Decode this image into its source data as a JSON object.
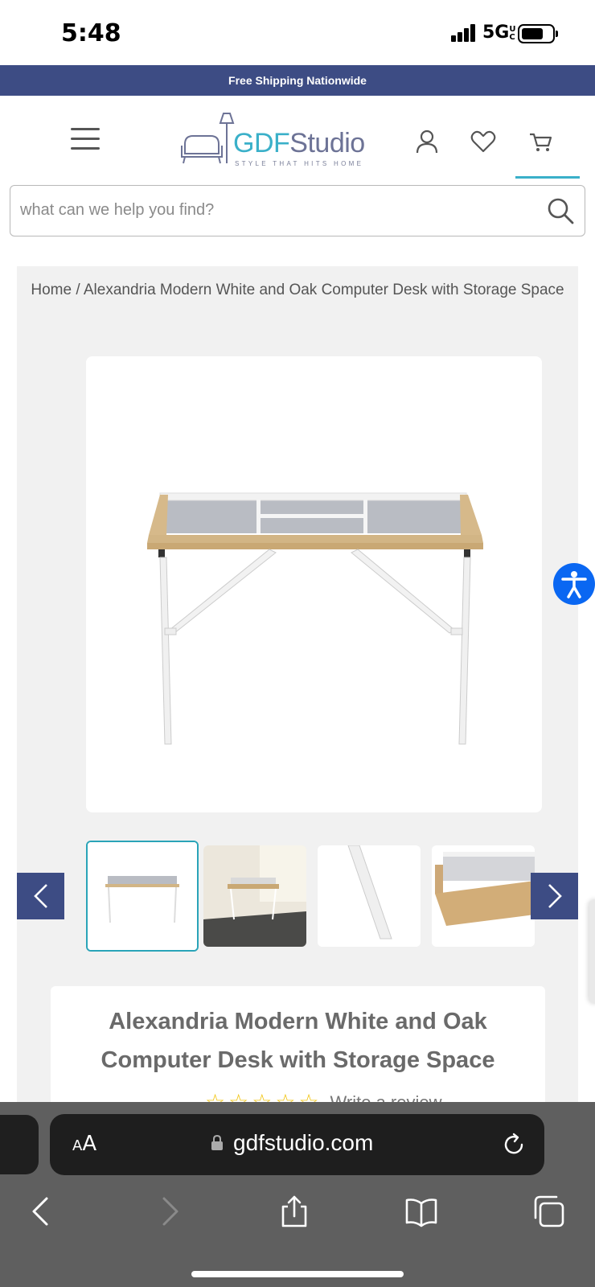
{
  "status_bar": {
    "time": "5:48",
    "network": "5G",
    "network_suffix": "UC"
  },
  "promo": {
    "text": "Free Shipping Nationwide"
  },
  "header": {
    "logo_gdf": "GDF",
    "logo_studio": "Studio",
    "logo_tagline": "STYLE THAT HITS HOME",
    "icons": [
      "menu-icon",
      "account-icon",
      "wishlist-heart-icon",
      "cart-icon"
    ]
  },
  "search": {
    "placeholder": "what can we help you find?",
    "value": ""
  },
  "breadcrumb": {
    "home": "Home",
    "separator": " / ",
    "current": "Alexandria Modern White and Oak Computer Desk with Storage Space"
  },
  "product": {
    "title": "Alexandria Modern White and Oak Computer Desk with Storage Space",
    "rating_stars": 0,
    "rating_max": 5,
    "write_review": "Write a review"
  },
  "gallery": {
    "active_index": 0,
    "thumbnails": [
      "desk-front",
      "desk-in-room",
      "desk-leg-closeup",
      "desk-hutch-closeup"
    ]
  },
  "browser": {
    "text_size_label_small": "A",
    "text_size_label_large": "A",
    "url": "gdfstudio.com",
    "toolbar": [
      "back-icon",
      "forward-icon",
      "share-icon",
      "bookmarks-icon",
      "tabs-icon"
    ]
  },
  "colors": {
    "brand_navy": "#3d4c84",
    "brand_teal": "#3ab0c9",
    "panel_bg": "#f1f1f1",
    "star": "#f1c40f"
  }
}
